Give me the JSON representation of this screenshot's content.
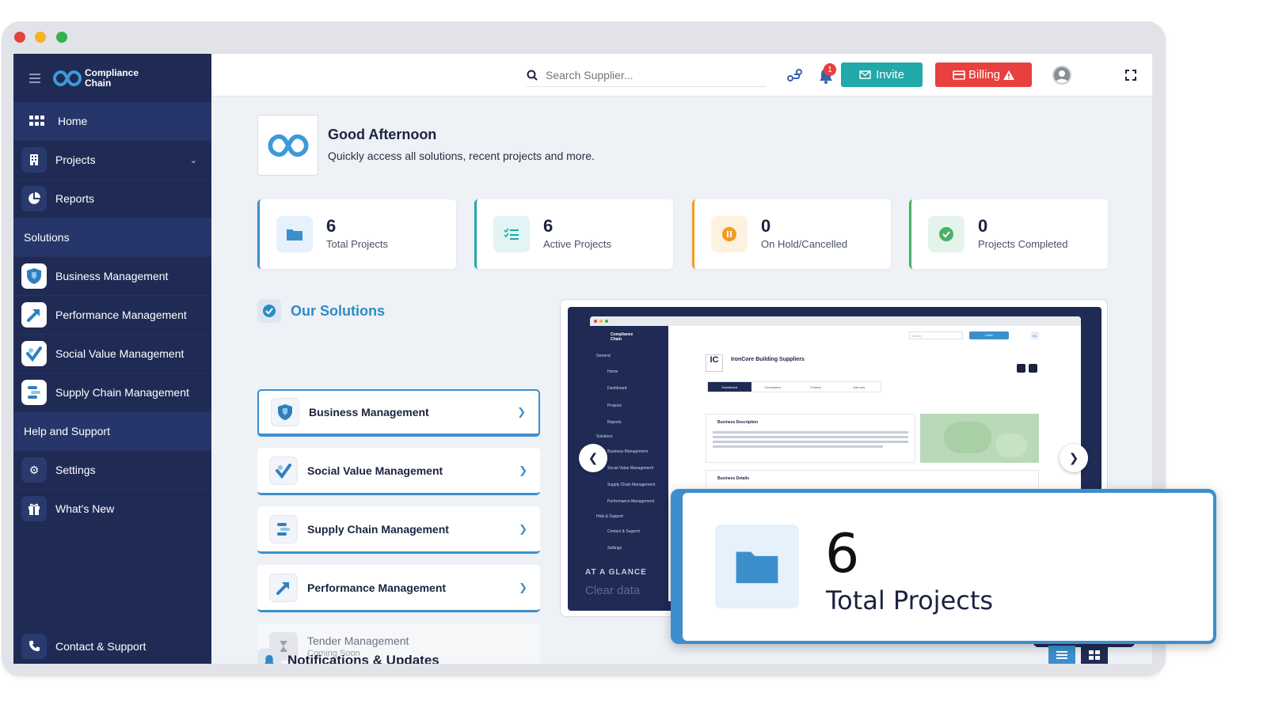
{
  "window": {
    "dots": [
      "#e0443e",
      "#f5b324",
      "#31b24a"
    ]
  },
  "brand": {
    "line1": "Compliance",
    "line2": "Chain"
  },
  "sidebar": {
    "home": "Home",
    "projects": "Projects",
    "reports": "Reports",
    "solutions_header": "Solutions",
    "solutions": [
      "Business Management",
      "Performance Management",
      "Social Value Management",
      "Supply Chain Management"
    ],
    "help_header": "Help and Support",
    "settings": "Settings",
    "whats_new": "What's New",
    "contact": "Contact & Support"
  },
  "topbar": {
    "search_placeholder": "Search Supplier...",
    "notification_count": "1",
    "invite_label": "Invite",
    "billing_label": "Billing",
    "colors": {
      "invite": "#21a8a8",
      "billing": "#e8403e"
    }
  },
  "greeting": {
    "title": "Good Afternoon",
    "subtitle": "Quickly access all solutions, recent projects and more."
  },
  "stats": [
    {
      "value": "6",
      "label": "Total Projects",
      "color": "#3d8fcc"
    },
    {
      "value": "6",
      "label": "Active Projects",
      "color": "#21a8a8"
    },
    {
      "value": "0",
      "label": "On Hold/Cancelled",
      "color": "#f29c1f"
    },
    {
      "value": "0",
      "label": "Projects Completed",
      "color": "#4bb068"
    }
  ],
  "solutions": {
    "title": "Our Solutions",
    "cards": [
      {
        "label": "Business Management"
      },
      {
        "label": "Social Value Management"
      },
      {
        "label": "Supply Chain Management"
      },
      {
        "label": "Performance Management"
      }
    ],
    "disabled": {
      "label": "Tender Management",
      "sub": "Coming Soon"
    }
  },
  "preview": {
    "company_abbr": "IC",
    "company_name": "IronCore Building Suppliers",
    "tabs": [
      "Dashboard",
      "Compliance",
      "Finance",
      "Add-ons"
    ],
    "mini_sidebar": [
      "General",
      "Home",
      "Dashboard",
      "Projects",
      "Reports",
      "Solutions",
      "Business Management",
      "Social Value Management",
      "Supply Chain Management",
      "Performance Management",
      "Help & Support",
      "Contact & Support",
      "Settings"
    ],
    "section1": "Business Description",
    "section2": "Business Details",
    "mini_search": "Search",
    "mini_invite": "Invite",
    "mini_avatar": "ML",
    "glance": "AT A GLANCE",
    "clear": "Clear data"
  },
  "notifications": {
    "title": "Notifications & Updates"
  },
  "popout": {
    "value": "6",
    "label": "Total Projects"
  }
}
